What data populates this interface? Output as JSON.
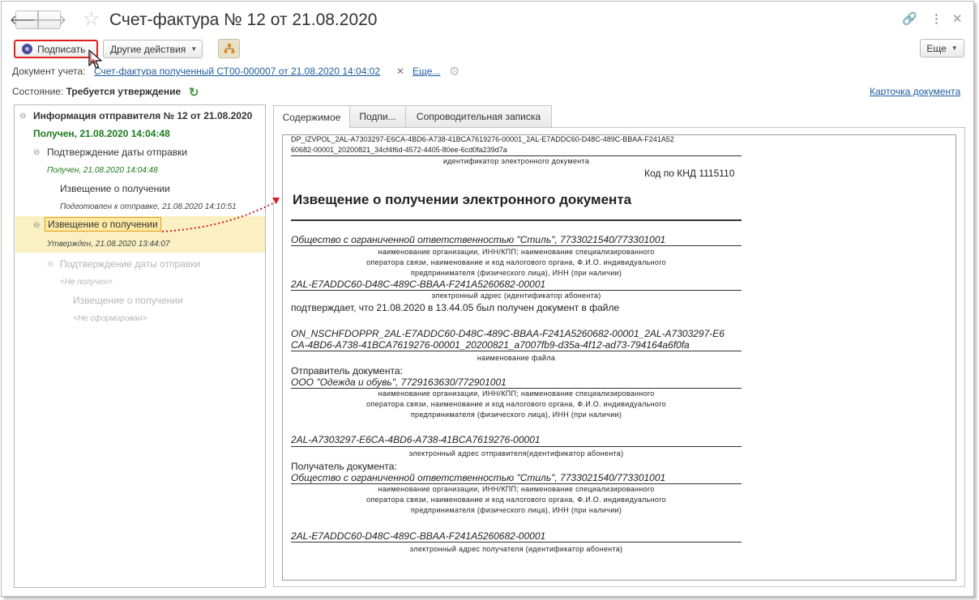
{
  "window": {
    "title": "Счет-фактура № 12 от 21.08.2020"
  },
  "toolbar": {
    "sign_label": "Подписать",
    "other_actions_label": "Другие действия",
    "more_label": "Еще"
  },
  "accounting": {
    "label": "Документ учета:",
    "link": "Счет-фактура полученный СТ00-000007 от 21.08.2020 14:04:02",
    "more_link": "Еще..."
  },
  "status": {
    "label": "Состояние:",
    "value": "Требуется утверждение",
    "card_link": "Карточка документа"
  },
  "tree": {
    "root_title": "Информация отправителя № 12 от 21.08.2020",
    "root_status": "Получен, 21.08.2020 14:04:48",
    "n1_title": "Подтверждение даты отправки",
    "n1_status": "Получен, 21.08.2020 14:04:48",
    "n1a_title": "Извещение о получении",
    "n1a_status": "Подготовлен к отправке, 21.08.2020 14:10:51",
    "n2_title": "Извещение о получении",
    "n2_status": "Утвержден, 21.08.2020 13:44:07",
    "n3_title": "Подтверждение даты отправки",
    "n3_status": "<Не получен>",
    "n3a_title": "Извещение о получении",
    "n3a_status": "<Не сформирован>"
  },
  "tabs": {
    "content": "Содержимое",
    "signatures": "Подпи...",
    "cover_note": "Сопроводительная записка"
  },
  "doc": {
    "file_id_line1": "DP_IZVPOL_2AL-A7303297-E6CA-4BD6-A738-41BCA7619276-00001_2AL-E7ADDC60-D48C-489C-BBAA-F241A52",
    "file_id_line2": "60682-00001_20200821_34cf4f6d-4572-4405-80ee-6cd0fa239d7a",
    "file_id_caption": "идентификатор электронного документа",
    "knd": "Код по КНД 1115110",
    "heading": "Извещение о получении электронного документа",
    "org1": "Общество с ограниченной ответственностью \"Стиль\", 7733021540/773301001",
    "org_caption_1": "наименование организации, ИНН/КПП; наименование специализированного",
    "org_caption_2": "оператора связи, наименование и код налогового органа, Ф.И.О. индивидуального",
    "org_caption_3": "предпринимателя (физического лица), ИНН (при наличии)",
    "addr1": "2AL-E7ADDC60-D48C-489C-BBAA-F241A5260682-00001",
    "addr1_caption": "электронный адрес (идентификатор абонента)",
    "confirms": "подтверждает, что 21.08.2020 в 13.44.05 был получен документ в файле",
    "filename_line1": "ON_NSCHFDOPPR_2AL-E7ADDC60-D48C-489C-BBAA-F241A5260682-00001_2AL-A7303297-E6",
    "filename_line2": "CA-4BD6-A738-41BCA7619276-00001_20200821_a7007fb9-d35a-4f12-ad73-794164a6f0fa",
    "filename_caption": "наименование файла",
    "sender_label": "Отправитель документа:",
    "sender": "ООО \"Одежда и обувь\", 7729163630/772901001",
    "sender_addr": "2AL-A7303297-E6CA-4BD6-A738-41BCA7619276-00001",
    "sender_addr_caption": "электронный адрес отправителя(идентификатор абонента)",
    "receiver_label": "Получатель документа:",
    "receiver": "Общество с ограниченной ответственностью \"Стиль\", 7733021540/773301001",
    "receiver_addr": "2AL-E7ADDC60-D48C-489C-BBAA-F241A5260682-00001",
    "receiver_addr_caption": "электронный адрес получателя (идентификатор абонента)"
  }
}
